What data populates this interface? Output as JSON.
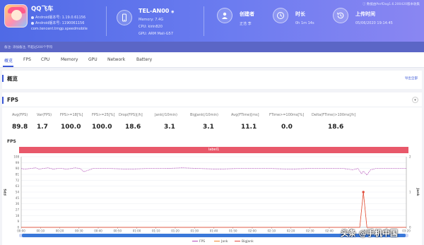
{
  "app": {
    "name": "QQ飞车",
    "version_line": "Android版本号: 1.19.0.61156",
    "build_line": "Android版本号: 1190061156",
    "package": "com.tencent.tmgp.speedmobile"
  },
  "device": {
    "name": "TEL-AN00",
    "memory": "Memory: 7.4G",
    "cpu": "CPU: kirin820",
    "gpu": "GPU: ARM Mali-G57"
  },
  "stats": {
    "creator_label": "创建者",
    "creator_value": "正浩 李",
    "duration_label": "时长",
    "duration_value": "0h 1m 14s",
    "upload_label": "上传时间",
    "upload_value": "05/06/2020 19:14:45"
  },
  "top_note": "数据由PerfDog1.6.200420版本收集",
  "remark": "备注:  添加备注,  不超过200个字符",
  "tabs": [
    "概览",
    "FPS",
    "CPU",
    "Memory",
    "GPU",
    "Network",
    "Battery"
  ],
  "overview": {
    "title": "概览",
    "export_label": "导出全部"
  },
  "fps_panel": {
    "title": "FPS",
    "collapse": "▾",
    "metrics": [
      {
        "label": "Avg(FPS)",
        "value": "89.8"
      },
      {
        "label": "Var(FPS)",
        "value": "1.7"
      },
      {
        "label": "FPS>=18[%]",
        "value": "100.0"
      },
      {
        "label": "FPS>=25[%]",
        "value": "100.0"
      },
      {
        "label": "Drop(FPS)[/h]",
        "value": "18.6"
      },
      {
        "label": "Jank(/10min)",
        "value": "3.1"
      },
      {
        "label": "BigJank(/10min)",
        "value": "3.1"
      },
      {
        "label": "Avg(FTime)[ms]",
        "value": "11.1"
      },
      {
        "label": "FTime>=100ms[%]",
        "value": "0.0"
      },
      {
        "label": "Delta(FTime)>100ms[/h]",
        "value": "18.6"
      }
    ]
  },
  "chart_data": {
    "type": "line",
    "title": "FPS",
    "band_label": "label1",
    "ylabel": "FPS",
    "y2label": "Jank",
    "ylim": [
      0,
      108
    ],
    "y_ticks": [
      0,
      9,
      18,
      27,
      36,
      45,
      54,
      63,
      72,
      81,
      90,
      99,
      108
    ],
    "y2lim": [
      0,
      2
    ],
    "y2_ticks": [
      0,
      1,
      2
    ],
    "x_ticks": [
      "00:00",
      "00:10",
      "00:20",
      "00:30",
      "00:40",
      "00:50",
      "01:00",
      "01:10",
      "01:20",
      "01:30",
      "01:40",
      "01:50",
      "02:00",
      "02:10",
      "02:20",
      "02:30",
      "02:40",
      "02:50",
      "03:00",
      "03:10",
      "03:20"
    ],
    "series": [
      {
        "name": "FPS",
        "color": "#b24ab8",
        "axis": "left",
        "x": [
          0,
          2,
          5,
          8,
          10,
          12,
          15,
          18,
          20,
          23,
          25,
          28,
          30,
          33,
          35,
          40,
          50,
          60,
          70,
          80,
          90,
          100,
          110,
          120,
          130,
          140,
          150,
          160,
          170,
          180,
          185,
          188,
          190,
          191,
          193,
          195,
          198,
          200,
          210,
          215
        ],
        "y": [
          90,
          89,
          90,
          91,
          89,
          90,
          91,
          89,
          90,
          90,
          89,
          90,
          91,
          90,
          85,
          90,
          90,
          89,
          90,
          90,
          91,
          90,
          89,
          90,
          90,
          90,
          89,
          90,
          90,
          90,
          88,
          90,
          82,
          86,
          80,
          88,
          90,
          90,
          90,
          90
        ]
      },
      {
        "name": "Jank",
        "color": "#f0832f",
        "axis": "right",
        "x": [
          0,
          189,
          191,
          193,
          215
        ],
        "y": [
          0,
          0,
          1,
          0,
          0
        ]
      },
      {
        "name": "BigJank",
        "color": "#e04a3f",
        "axis": "right",
        "x": [
          0,
          189,
          191,
          193,
          215
        ],
        "y": [
          0,
          0,
          1,
          0,
          0
        ]
      }
    ]
  },
  "watermark": "头条 @手机中国"
}
